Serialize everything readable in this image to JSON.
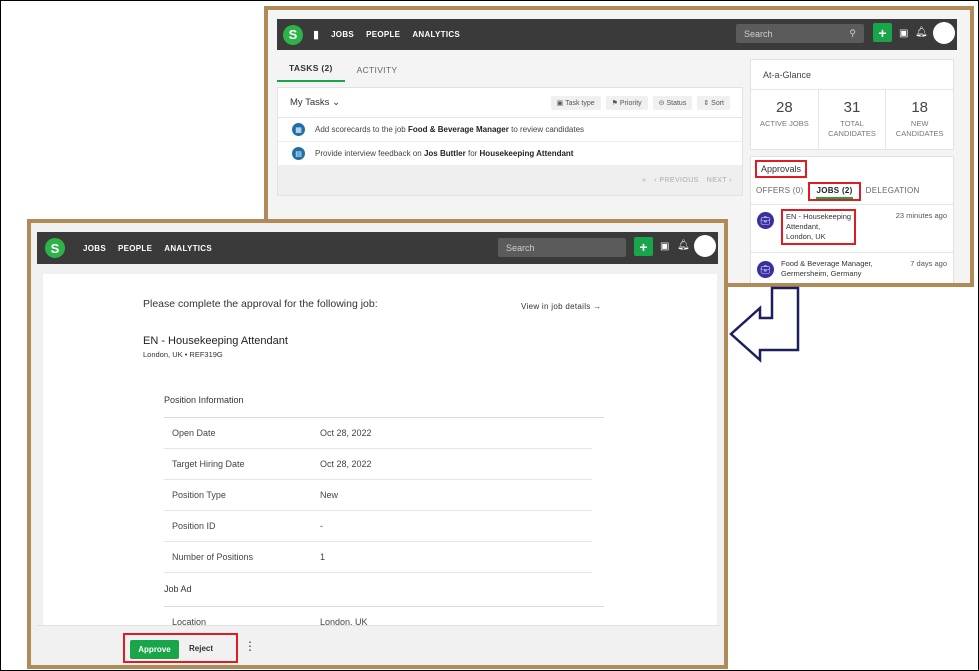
{
  "topbar": {
    "logo_letter": "S",
    "nav": [
      "JOBS",
      "PEOPLE",
      "ANALYTICS"
    ],
    "search_placeholder": "Search",
    "plus_label": "+"
  },
  "dashboard": {
    "tabs": [
      {
        "label": "TASKS (2)",
        "active": true
      },
      {
        "label": "ACTIVITY",
        "active": false
      }
    ],
    "my_tasks": {
      "title": "My Tasks",
      "filters": [
        "Task type",
        "Priority",
        "Status",
        "Sort"
      ],
      "tasks": [
        {
          "pre": "Add scorecards to the job ",
          "b1": "Food & Beverage Manager",
          "mid": " to review candidates",
          "b2": "",
          "post": ""
        },
        {
          "pre": "Provide interview feedback on ",
          "b1": "Jos Buttler",
          "mid": " for ",
          "b2": "Housekeeping Attendant",
          "post": ""
        }
      ],
      "pager": {
        "previous": "PREVIOUS",
        "next": "NEXT"
      }
    },
    "at_a_glance": {
      "title": "At-a-Glance",
      "stats": [
        {
          "value": "28",
          "line1": "ACTIVE JOBS",
          "line2": ""
        },
        {
          "value": "31",
          "line1": "TOTAL",
          "line2": "CANDIDATES"
        },
        {
          "value": "18",
          "line1": "NEW",
          "line2": "CANDIDATES"
        }
      ]
    },
    "approvals": {
      "title": "Approvals",
      "tabs": [
        "OFFERS (0)",
        "JOBS (2)",
        "DELEGATION"
      ],
      "items": [
        {
          "line1": "EN - Housekeeping",
          "line2": "Attendant,",
          "line3": "London, UK",
          "time": "23 minutes ago"
        },
        {
          "line1": "Food & Beverage Manager,",
          "line2": "Germersheim, Germany",
          "line3": "",
          "time": "7 days ago"
        }
      ]
    }
  },
  "approval_page": {
    "heading": "Please complete the approval for the following job:",
    "view_link": "View in job details",
    "job_title": "EN - Housekeeping Attendant",
    "job_subtitle": "London, UK • REF319G",
    "position_section": "Position Information",
    "position_rows": [
      {
        "label": "Open Date",
        "value": "Oct 28, 2022"
      },
      {
        "label": "Target Hiring Date",
        "value": "Oct 28, 2022"
      },
      {
        "label": "Position Type",
        "value": "New"
      },
      {
        "label": "Position ID",
        "value": "-"
      },
      {
        "label": "Number of Positions",
        "value": "1"
      }
    ],
    "jobad_section": "Job Ad",
    "jobad_rows": [
      {
        "label": "Location",
        "value": "London, UK"
      }
    ],
    "approve_label": "Approve",
    "reject_label": "Reject"
  },
  "colors": {
    "accent_green": "#19a64a",
    "highlight_red": "#e01b24",
    "frame_brown": "#b08a57",
    "arrow_navy": "#1b1f5c"
  }
}
